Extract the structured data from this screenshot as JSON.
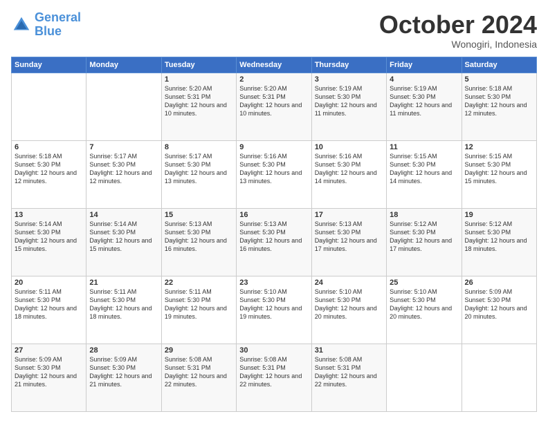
{
  "header": {
    "logo_general": "General",
    "logo_blue": "Blue",
    "month_title": "October 2024",
    "location": "Wonogiri, Indonesia"
  },
  "weekdays": [
    "Sunday",
    "Monday",
    "Tuesday",
    "Wednesday",
    "Thursday",
    "Friday",
    "Saturday"
  ],
  "weeks": [
    [
      null,
      null,
      {
        "day": 1,
        "sunrise": "5:20 AM",
        "sunset": "5:31 PM",
        "daylight": "12 hours and 10 minutes."
      },
      {
        "day": 2,
        "sunrise": "5:20 AM",
        "sunset": "5:31 PM",
        "daylight": "12 hours and 10 minutes."
      },
      {
        "day": 3,
        "sunrise": "5:19 AM",
        "sunset": "5:30 PM",
        "daylight": "12 hours and 11 minutes."
      },
      {
        "day": 4,
        "sunrise": "5:19 AM",
        "sunset": "5:30 PM",
        "daylight": "12 hours and 11 minutes."
      },
      {
        "day": 5,
        "sunrise": "5:18 AM",
        "sunset": "5:30 PM",
        "daylight": "12 hours and 12 minutes."
      }
    ],
    [
      {
        "day": 6,
        "sunrise": "5:18 AM",
        "sunset": "5:30 PM",
        "daylight": "12 hours and 12 minutes."
      },
      {
        "day": 7,
        "sunrise": "5:17 AM",
        "sunset": "5:30 PM",
        "daylight": "12 hours and 12 minutes."
      },
      {
        "day": 8,
        "sunrise": "5:17 AM",
        "sunset": "5:30 PM",
        "daylight": "12 hours and 13 minutes."
      },
      {
        "day": 9,
        "sunrise": "5:16 AM",
        "sunset": "5:30 PM",
        "daylight": "12 hours and 13 minutes."
      },
      {
        "day": 10,
        "sunrise": "5:16 AM",
        "sunset": "5:30 PM",
        "daylight": "12 hours and 14 minutes."
      },
      {
        "day": 11,
        "sunrise": "5:15 AM",
        "sunset": "5:30 PM",
        "daylight": "12 hours and 14 minutes."
      },
      {
        "day": 12,
        "sunrise": "5:15 AM",
        "sunset": "5:30 PM",
        "daylight": "12 hours and 15 minutes."
      }
    ],
    [
      {
        "day": 13,
        "sunrise": "5:14 AM",
        "sunset": "5:30 PM",
        "daylight": "12 hours and 15 minutes."
      },
      {
        "day": 14,
        "sunrise": "5:14 AM",
        "sunset": "5:30 PM",
        "daylight": "12 hours and 15 minutes."
      },
      {
        "day": 15,
        "sunrise": "5:13 AM",
        "sunset": "5:30 PM",
        "daylight": "12 hours and 16 minutes."
      },
      {
        "day": 16,
        "sunrise": "5:13 AM",
        "sunset": "5:30 PM",
        "daylight": "12 hours and 16 minutes."
      },
      {
        "day": 17,
        "sunrise": "5:13 AM",
        "sunset": "5:30 PM",
        "daylight": "12 hours and 17 minutes."
      },
      {
        "day": 18,
        "sunrise": "5:12 AM",
        "sunset": "5:30 PM",
        "daylight": "12 hours and 17 minutes."
      },
      {
        "day": 19,
        "sunrise": "5:12 AM",
        "sunset": "5:30 PM",
        "daylight": "12 hours and 18 minutes."
      }
    ],
    [
      {
        "day": 20,
        "sunrise": "5:11 AM",
        "sunset": "5:30 PM",
        "daylight": "12 hours and 18 minutes."
      },
      {
        "day": 21,
        "sunrise": "5:11 AM",
        "sunset": "5:30 PM",
        "daylight": "12 hours and 18 minutes."
      },
      {
        "day": 22,
        "sunrise": "5:11 AM",
        "sunset": "5:30 PM",
        "daylight": "12 hours and 19 minutes."
      },
      {
        "day": 23,
        "sunrise": "5:10 AM",
        "sunset": "5:30 PM",
        "daylight": "12 hours and 19 minutes."
      },
      {
        "day": 24,
        "sunrise": "5:10 AM",
        "sunset": "5:30 PM",
        "daylight": "12 hours and 20 minutes."
      },
      {
        "day": 25,
        "sunrise": "5:10 AM",
        "sunset": "5:30 PM",
        "daylight": "12 hours and 20 minutes."
      },
      {
        "day": 26,
        "sunrise": "5:09 AM",
        "sunset": "5:30 PM",
        "daylight": "12 hours and 20 minutes."
      }
    ],
    [
      {
        "day": 27,
        "sunrise": "5:09 AM",
        "sunset": "5:30 PM",
        "daylight": "12 hours and 21 minutes."
      },
      {
        "day": 28,
        "sunrise": "5:09 AM",
        "sunset": "5:30 PM",
        "daylight": "12 hours and 21 minutes."
      },
      {
        "day": 29,
        "sunrise": "5:08 AM",
        "sunset": "5:31 PM",
        "daylight": "12 hours and 22 minutes."
      },
      {
        "day": 30,
        "sunrise": "5:08 AM",
        "sunset": "5:31 PM",
        "daylight": "12 hours and 22 minutes."
      },
      {
        "day": 31,
        "sunrise": "5:08 AM",
        "sunset": "5:31 PM",
        "daylight": "12 hours and 22 minutes."
      },
      null,
      null
    ]
  ]
}
